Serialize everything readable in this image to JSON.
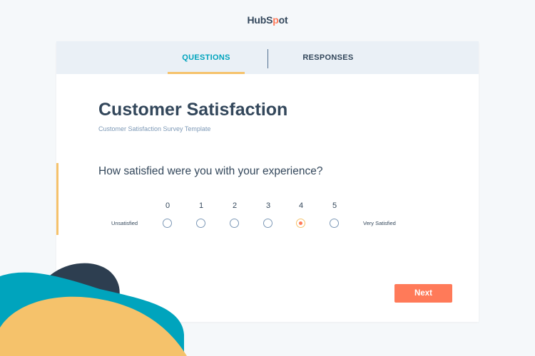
{
  "brand": {
    "logo_prefix": "HubS",
    "logo_accent": "p",
    "logo_suffix": "ot"
  },
  "tabs": [
    {
      "label": "QUESTIONS",
      "active": true
    },
    {
      "label": "RESPONSES",
      "active": false
    }
  ],
  "survey": {
    "title": "Customer Satisfaction",
    "subtitle": "Customer Satisfaction Survey Template",
    "question": "How satisfied were you with your experience?",
    "scale": {
      "low_label": "Unsatisfied",
      "high_label": "Very Satisfied",
      "options": [
        "0",
        "1",
        "2",
        "3",
        "4",
        "5"
      ],
      "selected": "4"
    }
  },
  "actions": {
    "next_label": "Next"
  },
  "colors": {
    "accent_orange": "#ff7a59",
    "accent_teal": "#00a4bd",
    "accent_yellow": "#f5c26b",
    "text_dark": "#33475b",
    "blob_navy": "#2d3e50",
    "blob_teal": "#00a4bd",
    "blob_yellow": "#f5c26b"
  }
}
